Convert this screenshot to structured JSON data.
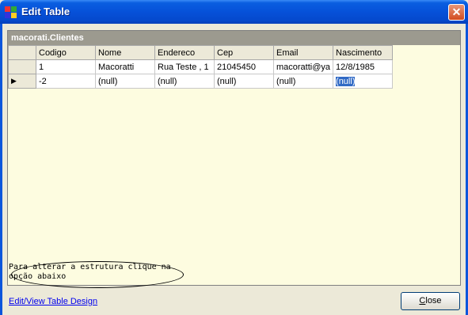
{
  "window": {
    "title": "Edit Table",
    "close_glyph": "✕"
  },
  "grid": {
    "caption": "macorati.Clientes",
    "columns": [
      "Codigo",
      "Nome",
      "Endereco",
      "Cep",
      "Email",
      "Nascimento"
    ],
    "rows": [
      {
        "indicator": "",
        "cells": [
          "1",
          "Macoratti",
          "Rua Teste , 1",
          "21045450",
          "macoratti@ya",
          "12/8/1985"
        ]
      },
      {
        "indicator": "▶",
        "cells": [
          "-2",
          "(null)",
          "(null)",
          "(null)",
          "(null)",
          "(null)"
        ]
      }
    ]
  },
  "annotation": {
    "text": "Para alterar a estrutura clique na opção abaixo"
  },
  "footer": {
    "design_link": "Edit/View Table Design",
    "close_label": "Close"
  },
  "colors": {
    "title_bar": "#0651d9",
    "grid_background": "#fdfce0",
    "selection": "#316ac5"
  }
}
